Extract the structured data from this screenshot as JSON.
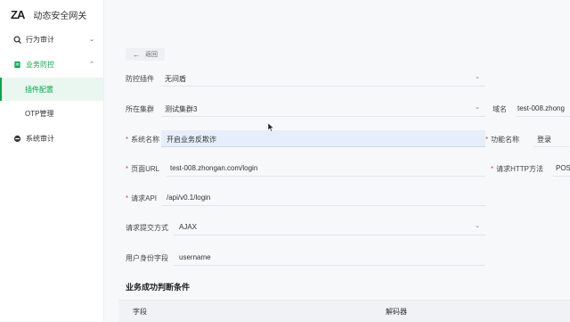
{
  "brand": {
    "logo": "ZA",
    "name": "动态安全网关"
  },
  "sidebar": {
    "items": [
      {
        "label": "行为审计",
        "icon": "audit-icon",
        "expanded": false
      },
      {
        "label": "业务防控",
        "icon": "shield-icon",
        "expanded": true,
        "children": [
          {
            "label": "插件配置",
            "selected": true
          },
          {
            "label": "OTP管理",
            "selected": false
          }
        ]
      },
      {
        "label": "系统审计",
        "icon": "system-audit-icon",
        "expanded": false
      }
    ]
  },
  "main": {
    "back_label": "返回",
    "form": {
      "plugin": {
        "label": "防控插件",
        "value": "无间盾"
      },
      "cluster": {
        "label": "所在集群",
        "value": "测试集群3"
      },
      "domain": {
        "label": "域名",
        "value": "test-008.zhong"
      },
      "system_name": {
        "label": "系统名称",
        "value": "开启业务反欺诈"
      },
      "function_name": {
        "label": "功能名称",
        "value": "登录"
      },
      "page_url": {
        "label": "页面URL",
        "value": "test-008.zhongan.com/login"
      },
      "http_method": {
        "label": "请求HTTP方法",
        "value": "POS"
      },
      "api": {
        "label": "请求API",
        "value": "/api/v0.1/login"
      },
      "submit_method": {
        "label": "请求提交方式",
        "value": "AJAX"
      },
      "user_field": {
        "label": "用户身份字段",
        "value": "username"
      }
    },
    "section_title": "业务成功判断条件",
    "table": {
      "columns": [
        "字段",
        "解码器"
      ]
    }
  },
  "colors": {
    "accent": "#0aa34d",
    "required": "#e5484d",
    "highlight": "#e6eefb"
  }
}
